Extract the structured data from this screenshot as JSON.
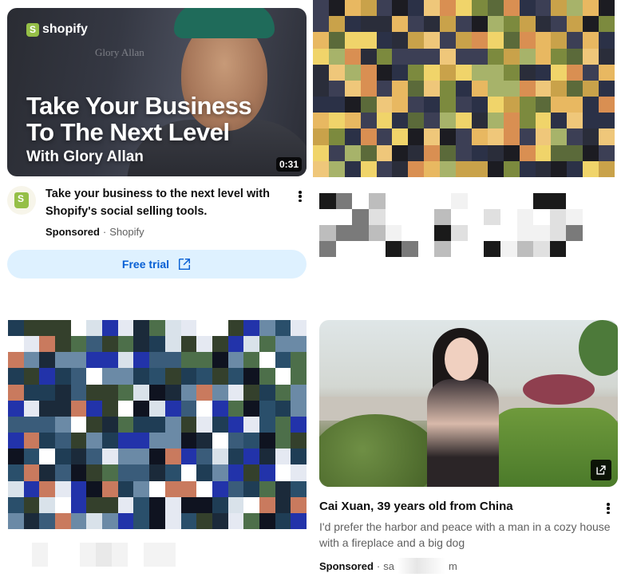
{
  "ads": [
    {
      "thumbnail": {
        "brand": "shopify",
        "background_sign": "Glory Allan",
        "headline_line1": "Take Your Business",
        "headline_line2": "To The Next Level",
        "subhead": "With Glory Allan",
        "duration": "0:31"
      },
      "channel_icon": "shopify-bag-icon",
      "title": "Take your business to the next level with Shopify's social selling tools.",
      "sponsored_label": "Sponsored",
      "separator": "·",
      "advertiser": "Shopify",
      "cta_label": "Free trial",
      "cta_icon": "external-link-icon"
    },
    {
      "title": "Cai Xuan, 39 years old from China",
      "description": "I'd prefer the harbor and peace with a man in a cozy house with a fireplace and a big dog",
      "sponsored_label": "Sponsored",
      "separator": "·",
      "advertiser_partial_start": "sa",
      "advertiser_partial_end": "m",
      "thumbnail_icon": "external-link-icon"
    }
  ],
  "colors": {
    "cta_bg": "#def1ff",
    "cta_text": "#065fd4",
    "shopify_green": "#95bf47",
    "meta_text": "#606060"
  }
}
